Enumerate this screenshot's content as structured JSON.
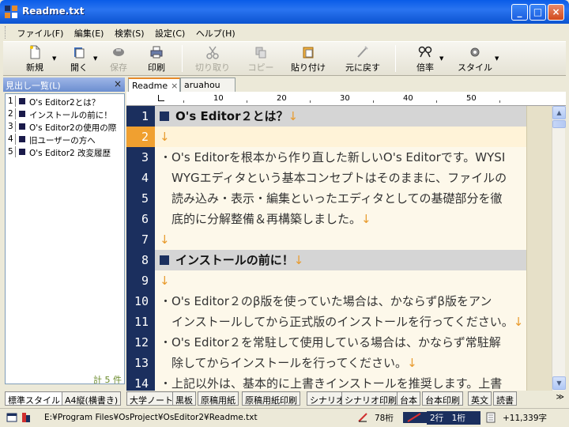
{
  "window": {
    "title": "Readme.txt",
    "min": "_",
    "max": "□",
    "close": "×"
  },
  "menu": [
    "ファイル(F)",
    "編集(E)",
    "検索(S)",
    "設定(C)",
    "ヘルプ(H)"
  ],
  "toolbar": {
    "new": "新規",
    "open": "開く",
    "save": "保存",
    "print": "印刷",
    "cut": "切り取り",
    "copy": "コピー",
    "paste": "貼り付け",
    "undo": "元に戻す",
    "zoom": "倍率",
    "style": "スタイル"
  },
  "outline": {
    "title": "見出し一覧(L)",
    "close": "×",
    "items": [
      {
        "num": "1",
        "text": "O's Editor2とは？"
      },
      {
        "num": "2",
        "text": "インストールの前に！"
      },
      {
        "num": "3",
        "text": "O's Editor2の使用の際"
      },
      {
        "num": "4",
        "text": "旧ユーザーの方へ"
      },
      {
        "num": "5",
        "text": "O's Editor2 改変履歴"
      }
    ],
    "count": "計 5 件"
  },
  "tabs": [
    {
      "label": "Readme",
      "close": "×"
    },
    {
      "label": "aruahou rubi",
      "close": ""
    }
  ],
  "ruler": [
    "10",
    "20",
    "30",
    "40",
    "50"
  ],
  "editor": {
    "lines": [
      {
        "n": "1",
        "text": "O's Editor２とは？",
        "nl": "↓"
      },
      {
        "n": "2",
        "text": "",
        "nl": "↓"
      },
      {
        "n": "3",
        "text": "・O's Editorを根本から作り直した新しいO's Editorです。WYSI",
        "nl": ""
      },
      {
        "n": "4",
        "text": "　WYGエディタという基本コンセプトはそのままに、ファイルの",
        "nl": ""
      },
      {
        "n": "5",
        "text": "　読み込み・表示・編集といったエディタとしての基礎部分を徹",
        "nl": ""
      },
      {
        "n": "6",
        "text": "　底的に分解整備＆再構築しました。",
        "nl": "↓"
      },
      {
        "n": "7",
        "text": "",
        "nl": "↓"
      },
      {
        "n": "8",
        "text": "インストールの前に！",
        "nl": "↓"
      },
      {
        "n": "9",
        "text": "",
        "nl": "↓"
      },
      {
        "n": "10",
        "text": "・O's Editor２のβ版を使っていた場合は、かならずβ版をアン",
        "nl": ""
      },
      {
        "n": "11",
        "text": "　インストールしてから正式版のインストールを行ってください。",
        "nl": "↓"
      },
      {
        "n": "12",
        "text": "・O's Editor２を常駐して使用している場合は、かならず常駐解",
        "nl": ""
      },
      {
        "n": "13",
        "text": "　除してからインストールを行ってください。",
        "nl": "↓"
      },
      {
        "n": "14",
        "text": "・上記以外は、基本的に上書きインストールを推奨します。上書",
        "nl": ""
      }
    ]
  },
  "style_tabs": [
    "標準スタイル",
    "A4縦(横書き)",
    "大学ノート",
    "黒板",
    "原稿用紙",
    "原稿用紙印刷",
    "シナリオ",
    "シナリオ印刷",
    "台本",
    "台本印刷",
    "英文",
    "読書"
  ],
  "style_nav": "≫",
  "status": {
    "path": "E:¥Program Files¥OsProject¥OsEditor2¥Readme.txt",
    "cols": "78桁",
    "pos": "2行　1桁",
    "chars": "+11,339字"
  },
  "colors": {
    "accent": "#e68b2c",
    "gutter": "#1b2f5e",
    "title_bar": "#0a5ce8"
  }
}
